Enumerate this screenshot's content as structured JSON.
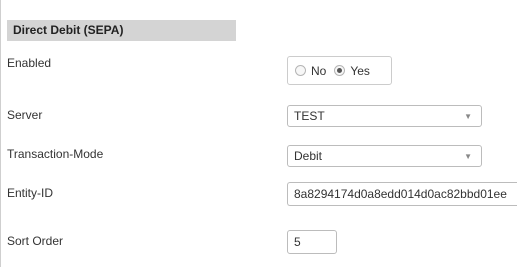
{
  "section": {
    "title": "Direct Debit (SEPA)"
  },
  "fields": {
    "enabled": {
      "label": "Enabled",
      "options": [
        "No",
        "Yes"
      ],
      "selected": "Yes"
    },
    "server": {
      "label": "Server",
      "value": "TEST",
      "icon": "chevron-down-icon"
    },
    "transaction_mode": {
      "label": "Transaction-Mode",
      "value": "Debit",
      "icon": "chevron-down-icon"
    },
    "entity_id": {
      "label": "Entity-ID",
      "value": "8a8294174d0a8edd014d0ac82bbd01ee"
    },
    "sort_order": {
      "label": "Sort Order",
      "value": "5"
    }
  },
  "colors": {
    "header_bg": "#d4d4d4",
    "border": "#bcbcbc",
    "text": "#333333"
  }
}
